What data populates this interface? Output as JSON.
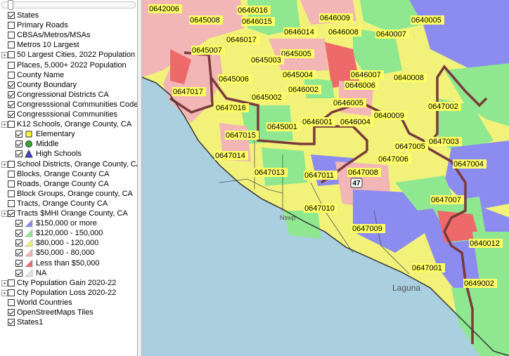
{
  "legend": {
    "items": [
      {
        "label": "States",
        "checked": true,
        "expandable": false,
        "indent": 0
      },
      {
        "label": "Primary Roads",
        "checked": false,
        "expandable": false,
        "indent": 0
      },
      {
        "label": "CBSAs/Metros/MSAs",
        "checked": false,
        "expandable": false,
        "indent": 0
      },
      {
        "label": "Metros 10 Largest",
        "checked": false,
        "expandable": false,
        "indent": 0
      },
      {
        "label": "50 Largest Cities, 2022 Population",
        "checked": false,
        "expandable": true,
        "indent": 0
      },
      {
        "label": "Places, 5,000+ 2022 Population",
        "checked": false,
        "expandable": false,
        "indent": 0
      },
      {
        "label": "County Name",
        "checked": false,
        "expandable": false,
        "indent": 0
      },
      {
        "label": "County Boundary",
        "checked": true,
        "expandable": false,
        "indent": 0
      },
      {
        "label": "Congressional Districts CA",
        "checked": true,
        "expandable": false,
        "indent": 0
      },
      {
        "label": "Congresssional Communities Code",
        "checked": true,
        "expandable": false,
        "indent": 0
      },
      {
        "label": "Congresssional Communities",
        "checked": true,
        "expandable": false,
        "indent": 0
      },
      {
        "label": "K12 Schools, Orange County, CA",
        "checked": false,
        "expandable": true,
        "indent": 0
      },
      {
        "label": "Elementary",
        "checked": true,
        "expandable": false,
        "indent": 1,
        "symbol": "square-yellow"
      },
      {
        "label": "Middle",
        "checked": true,
        "expandable": false,
        "indent": 1,
        "symbol": "circle-green"
      },
      {
        "label": "High Schools",
        "checked": true,
        "expandable": false,
        "indent": 1,
        "symbol": "triangle-blue"
      },
      {
        "label": "School Districts, Orange County, CA",
        "checked": false,
        "expandable": true,
        "indent": 0
      },
      {
        "label": "Blocks, Orange County CA",
        "checked": false,
        "expandable": false,
        "indent": 0
      },
      {
        "label": "Roads, Orange County CA",
        "checked": false,
        "expandable": false,
        "indent": 0
      },
      {
        "label": "Block Groups, Orange county, CA",
        "checked": false,
        "expandable": false,
        "indent": 0
      },
      {
        "label": "Tracts, Orange County CA",
        "checked": false,
        "expandable": false,
        "indent": 0
      },
      {
        "label": "Tracts $MHI Orange County, CA",
        "checked": true,
        "expandable": true,
        "indent": 0
      },
      {
        "label": "$150,000 or more",
        "checked": true,
        "expandable": false,
        "indent": 1,
        "symbol": "swatch-blue"
      },
      {
        "label": "$120,000 - 150,000",
        "checked": true,
        "expandable": false,
        "indent": 1,
        "symbol": "swatch-green"
      },
      {
        "label": "$80,000 - 120,000",
        "checked": true,
        "expandable": false,
        "indent": 1,
        "symbol": "swatch-yellow"
      },
      {
        "label": "$50,000 - 80,000",
        "checked": true,
        "expandable": false,
        "indent": 1,
        "symbol": "swatch-pink"
      },
      {
        "label": "Less than $50,000",
        "checked": true,
        "expandable": false,
        "indent": 1,
        "symbol": "swatch-red"
      },
      {
        "label": "NA",
        "checked": true,
        "expandable": false,
        "indent": 1,
        "symbol": "swatch-gray"
      },
      {
        "label": "Cty Population Gain 2020-22",
        "checked": false,
        "expandable": true,
        "indent": 0
      },
      {
        "label": "Cty Population Loss 2020-22",
        "checked": false,
        "expandable": true,
        "indent": 0
      },
      {
        "label": "World Countries",
        "checked": false,
        "expandable": false,
        "indent": 0
      },
      {
        "label": "OpenStreetMaps Tiles",
        "checked": true,
        "expandable": false,
        "indent": 0
      },
      {
        "label": "States1",
        "checked": true,
        "expandable": false,
        "indent": 0
      }
    ]
  },
  "colors": {
    "high": "#8c8cf0",
    "upper": "#8fe88f",
    "mid": "#f2f27a",
    "lower": "#f2b6b6",
    "low": "#ee6a6a",
    "na": "#e6e6e6",
    "ocean": "#aacfdf",
    "district_line": "#7a3a3a"
  },
  "map": {
    "labels": [
      {
        "text": "0642006"
      },
      {
        "text": "0646016"
      },
      {
        "text": "0646009"
      },
      {
        "text": "0640005"
      },
      {
        "text": "0645008"
      },
      {
        "text": "0646015"
      },
      {
        "text": "0646014"
      },
      {
        "text": "0646008"
      },
      {
        "text": "0640007"
      },
      {
        "text": "0646017"
      },
      {
        "text": "0645007"
      },
      {
        "text": "0645005"
      },
      {
        "text": "0645003"
      },
      {
        "text": "0645004"
      },
      {
        "text": "0646007"
      },
      {
        "text": "0640008"
      },
      {
        "text": "0645006"
      },
      {
        "text": "0646006"
      },
      {
        "text": "0647017"
      },
      {
        "text": "0645002"
      },
      {
        "text": "0646002"
      },
      {
        "text": "0646005"
      },
      {
        "text": "0647002"
      },
      {
        "text": "0647016"
      },
      {
        "text": "0640009"
      },
      {
        "text": "0646001"
      },
      {
        "text": "0646004"
      },
      {
        "text": "0645001"
      },
      {
        "text": "0647015"
      },
      {
        "text": "0647005"
      },
      {
        "text": "0647003"
      },
      {
        "text": "0647014"
      },
      {
        "text": "0647006"
      },
      {
        "text": "0647004"
      },
      {
        "text": "0647013"
      },
      {
        "text": "0647011"
      },
      {
        "text": "0647008"
      },
      {
        "text": "0647010"
      },
      {
        "text": "0647007"
      },
      {
        "text": "0647009"
      },
      {
        "text": "0640012"
      },
      {
        "text": "0647001"
      },
      {
        "text": "0649002"
      }
    ],
    "shield": "47",
    "place_labels": [
      "Laguna",
      "Nswp"
    ]
  }
}
